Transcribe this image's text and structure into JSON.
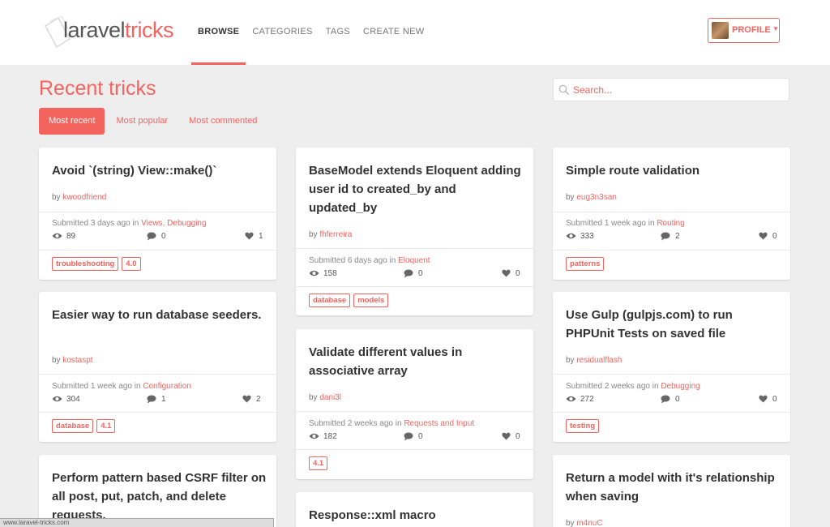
{
  "brand": {
    "part1": "laravel",
    "part2": "tricks"
  },
  "nav": [
    {
      "label": "BROWSE",
      "active": true
    },
    {
      "label": "CATEGORIES",
      "active": false
    },
    {
      "label": "TAGS",
      "active": false
    },
    {
      "label": "CREATE NEW",
      "active": false
    }
  ],
  "profile": {
    "label": "PROFILE"
  },
  "page": {
    "title": "Recent tricks"
  },
  "search": {
    "placeholder": "Search..."
  },
  "filters": [
    {
      "label": "Most recent",
      "active": true
    },
    {
      "label": "Most popular",
      "active": false
    },
    {
      "label": "Most commented",
      "active": false
    }
  ],
  "byline_prefix": "by",
  "submitted_prefix": "Submitted",
  "in_word": "in",
  "cards": [
    {
      "title": "Avoid `(string) View::make()`",
      "author": "kwoodfriend",
      "time": "3 days ago",
      "categories": "Views, Debugging",
      "views": "89",
      "comments": "0",
      "likes": "1",
      "tags": [
        "troubleshooting",
        "4.0"
      ]
    },
    {
      "title": "BaseModel extends Eloquent adding user id to created_by and updated_by",
      "author": "fhferreira",
      "time": "6 days ago",
      "categories": "Eloquent",
      "views": "158",
      "comments": "0",
      "likes": "0",
      "tags": [
        "database",
        "models"
      ]
    },
    {
      "title": "Simple route validation",
      "author": "eug3n3san",
      "time": "1 week ago",
      "categories": "Routing",
      "views": "333",
      "comments": "2",
      "likes": "0",
      "tags": [
        "patterns"
      ]
    },
    {
      "title": "Easier way to run database seeders.",
      "author": "kostaspt",
      "time": "1 week ago",
      "categories": "Configuration",
      "views": "304",
      "comments": "1",
      "likes": "2",
      "tags": [
        "database",
        "4.1"
      ]
    },
    {
      "title": "Validate different values in associative array",
      "author": "dani3l",
      "time": "2 weeks ago",
      "categories": "Requests and Input",
      "views": "182",
      "comments": "0",
      "likes": "0",
      "tags": [
        "4.1"
      ]
    },
    {
      "title": "Use Gulp (gulpjs.com) to run PHPUnit Tests on saved file",
      "author": "residualflash",
      "time": "2 weeks ago",
      "categories": "Debugging",
      "views": "272",
      "comments": "0",
      "likes": "0",
      "tags": [
        "testing"
      ]
    },
    {
      "title": "Perform pattern based CSRF filter on all post, put, patch, and delete requests."
    },
    {
      "title": "Response::xml macro"
    },
    {
      "title": "Return a model with it's relationship when saving",
      "author": "m4nuC"
    }
  ],
  "status_bar": "www.laravel-tricks.com",
  "colors": {
    "accent": "#f4645f",
    "background": "#eeeeee"
  }
}
